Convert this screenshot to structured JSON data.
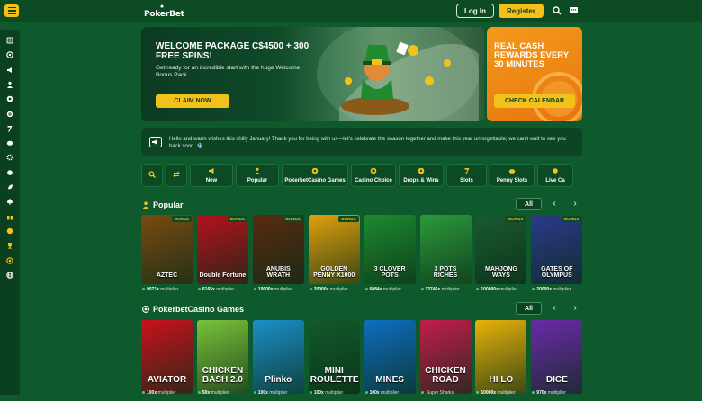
{
  "header": {
    "logo_text": "PokerBet",
    "login_label": "Log In",
    "register_label": "Register"
  },
  "sidebar": {
    "icons": [
      "news-icon",
      "poker-chip-icon",
      "megaphone-icon",
      "user-icon",
      "casino-chip-icon",
      "target-icon",
      "seven-icon",
      "piggy-icon",
      "gear-icon",
      "live-icon",
      "rocket-icon",
      "spade-icon",
      "gift-icon",
      "coin-icon",
      "trophy-icon",
      "star-icon",
      "globe-icon"
    ]
  },
  "hero": {
    "title": "WELCOME PACKAGE C$4500 + 300 FREE SPINS!",
    "subtitle": "Get ready for an incredible start with the huge Welcome Bonus Pack.",
    "button": "CLAIM NOW"
  },
  "promo2": {
    "title": "REAL CASH REWARDS EVERY 30 MINUTES",
    "button": "CHECK CALENDAR"
  },
  "notice": {
    "text": "Hello and warm wishes this chilly January! Thank you for being with us—let's celebrate the season together and make this year unforgettable; we can't wait to see you back soon. ❄️"
  },
  "categories": [
    {
      "label": "",
      "icon": "search-icon"
    },
    {
      "label": "",
      "icon": "filter-icon"
    },
    {
      "label": "New",
      "icon": "megaphone-icon"
    },
    {
      "label": "Popular",
      "icon": "user-icon"
    },
    {
      "label": "PokerbetCasino Games",
      "icon": "casino-chip-icon"
    },
    {
      "label": "Casino Choice",
      "icon": "target-icon"
    },
    {
      "label": "Drops & Wins",
      "icon": "drop-icon"
    },
    {
      "label": "Slots",
      "icon": "seven-icon"
    },
    {
      "label": "Penny Slots",
      "icon": "piggy-icon"
    },
    {
      "label": "Live Ca",
      "icon": "live-icon"
    }
  ],
  "popular": {
    "title": "Popular",
    "all_label": "All",
    "games": [
      {
        "name": "AZTEC",
        "badge": "BONUS",
        "mult": "9071x",
        "mult_label": "multiplier",
        "color": "#7a4a12"
      },
      {
        "name": "Double Fortune",
        "badge": "BONUS",
        "mult": "6165x",
        "mult_label": "multiplier",
        "color": "#b3121c"
      },
      {
        "name": "ANUBIS WRATH",
        "badge": "BONUS",
        "mult": "10000x",
        "mult_label": "multiplier",
        "color": "#5a2a10"
      },
      {
        "name": "GOLDEN PENNY X1000",
        "badge": "BONUS",
        "mult": "20000x",
        "mult_label": "multiplier",
        "color": "#e0a10d"
      },
      {
        "name": "3 CLOVER POTS",
        "badge": "",
        "mult": "6084x",
        "mult_label": "multiplier",
        "color": "#1d8a2e"
      },
      {
        "name": "3 POTS RICHES",
        "badge": "",
        "mult": "13746x",
        "mult_label": "multiplier",
        "color": "#2c9a3a"
      },
      {
        "name": "MAHJONG WAYS",
        "badge": "BONUS",
        "mult": "100000x",
        "mult_label": "multiplier",
        "color": "#1a5a30"
      },
      {
        "name": "GATES OF OLYMPUS",
        "badge": "BONUS",
        "mult": "20000x",
        "mult_label": "multiplier",
        "color": "#2a3a8a"
      }
    ]
  },
  "casino_games": {
    "title": "PokerbetCasino Games",
    "all_label": "All",
    "games": [
      {
        "name": "AVIATOR",
        "color": "#c8121c",
        "mult": "100x",
        "mult_label": "multiplier"
      },
      {
        "name": "CHICKEN BASH 2.0",
        "color": "#7ac23a",
        "mult": "50x",
        "mult_label": "multiplier"
      },
      {
        "name": "Plinko",
        "color": "#1a90c8",
        "mult": "100x",
        "mult_label": "multiplier"
      },
      {
        "name": "MINI ROULETTE",
        "color": "#125a2a",
        "mult": "100x",
        "mult_label": "multiplier"
      },
      {
        "name": "MINES",
        "color": "#0e6ec0",
        "mult": "100x",
        "mult_label": "multiplier"
      },
      {
        "name": "CHICKEN ROAD",
        "color": "#c21d4a",
        "mult": "",
        "mult_label": "Super Sharks"
      },
      {
        "name": "HI LO",
        "color": "#e8b20a",
        "mult": "10000x",
        "mult_label": "multiplier"
      },
      {
        "name": "DICE",
        "color": "#6a2aa8",
        "mult": "970x",
        "mult_label": "multiplier"
      }
    ]
  },
  "colors": {
    "accent": "#f2c21a",
    "bg": "#0f5a2c",
    "header": "#0b4a22"
  }
}
